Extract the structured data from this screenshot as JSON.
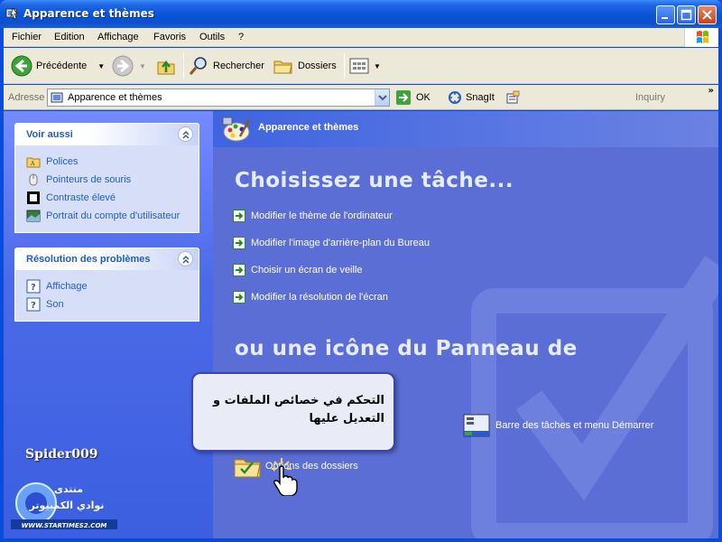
{
  "window": {
    "title": "Apparence et thèmes",
    "accent_color": "#0a4bd9"
  },
  "menu": {
    "items": [
      "Fichier",
      "Edition",
      "Affichage",
      "Favoris",
      "Outils",
      "?"
    ]
  },
  "toolbar": {
    "back_label": "Précédente",
    "search_label": "Rechercher",
    "folders_label": "Dossiers"
  },
  "address": {
    "label": "Adresse",
    "value": "Apparence et thèmes",
    "go_label": "OK",
    "snagit_label": "SnagIt",
    "inquiry_label": "Inquiry",
    "more_chevron": "»"
  },
  "sidebar": {
    "see_also": {
      "title": "Voir aussi",
      "items": [
        {
          "label": "Polices",
          "icon": "folder-icon"
        },
        {
          "label": "Pointeurs de souris",
          "icon": "mouse-icon"
        },
        {
          "label": "Contraste élevé",
          "icon": "contrast-icon"
        },
        {
          "label": "Portrait du compte d'utilisateur",
          "icon": "user-picture-icon"
        }
      ]
    },
    "troubleshoot": {
      "title": "Résolution des problèmes",
      "items": [
        {
          "label": "Affichage",
          "icon": "help-icon"
        },
        {
          "label": "Son",
          "icon": "help-icon"
        }
      ]
    },
    "watermark_name": "Spider009",
    "watermark_logo_text": [
      "منتدى",
      "نوادي الكمبيوتر",
      "WWW.STARTIMES2.COM"
    ]
  },
  "main": {
    "header_title": "Apparence et thèmes",
    "pick_task_heading": "Choisissez une tâche...",
    "tasks": [
      "Modifier le thème de l'ordinateur",
      "Modifier l'image d'arrière-plan du Bureau",
      "Choisir un écran de veille",
      "Modifier la résolution de l'écran"
    ],
    "or_icon_heading": "ou une icône du Panneau de",
    "icons": [
      {
        "label": "Barre des tâches et menu Démarrer",
        "icon": "taskbar-icon"
      },
      {
        "label": "Options des dossiers",
        "icon": "folder-options-icon"
      }
    ]
  },
  "callout": {
    "text": "التحكم في خصائص الملفات و التعديل عليها"
  }
}
